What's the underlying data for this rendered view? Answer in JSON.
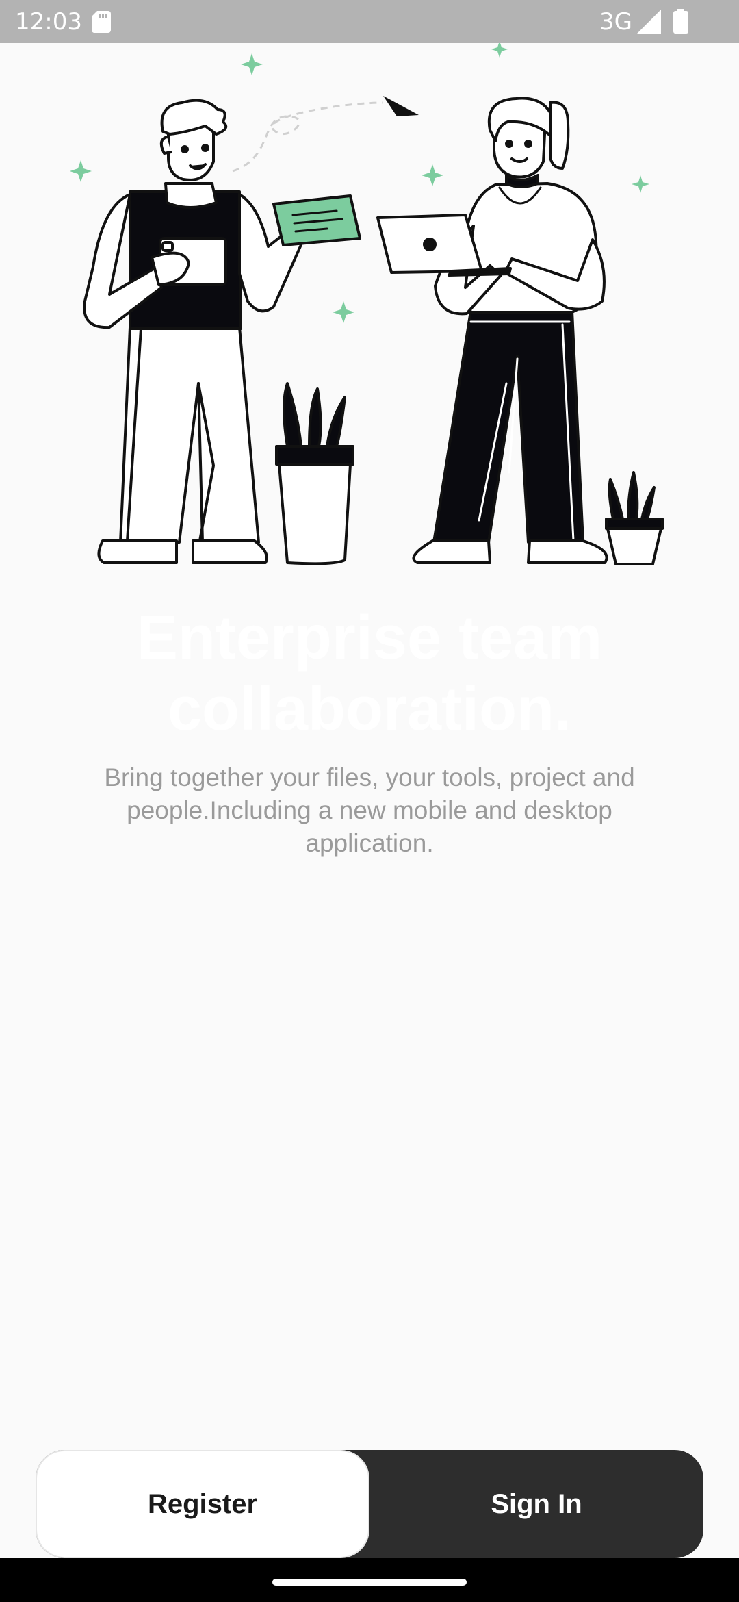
{
  "status_bar": {
    "time": "12:03",
    "network": "3G",
    "icons": [
      "sd-card-icon",
      "signal-icon",
      "battery-icon"
    ]
  },
  "illustration": {
    "description_icon": "team-collaboration-illustration",
    "accent_color": "#7ccc9e"
  },
  "onboarding": {
    "title": "Enterprise team collaboration.",
    "subtitle": "Bring together your files, your tools, project and people.Including a new mobile and desktop application."
  },
  "actions": {
    "register_label": "Register",
    "signin_label": "Sign In"
  },
  "colors": {
    "background": "#fafafa",
    "status_bar": "#b3b3b3",
    "button_dark": "#2d2d2d",
    "subtitle_text": "#9a9a9a"
  }
}
